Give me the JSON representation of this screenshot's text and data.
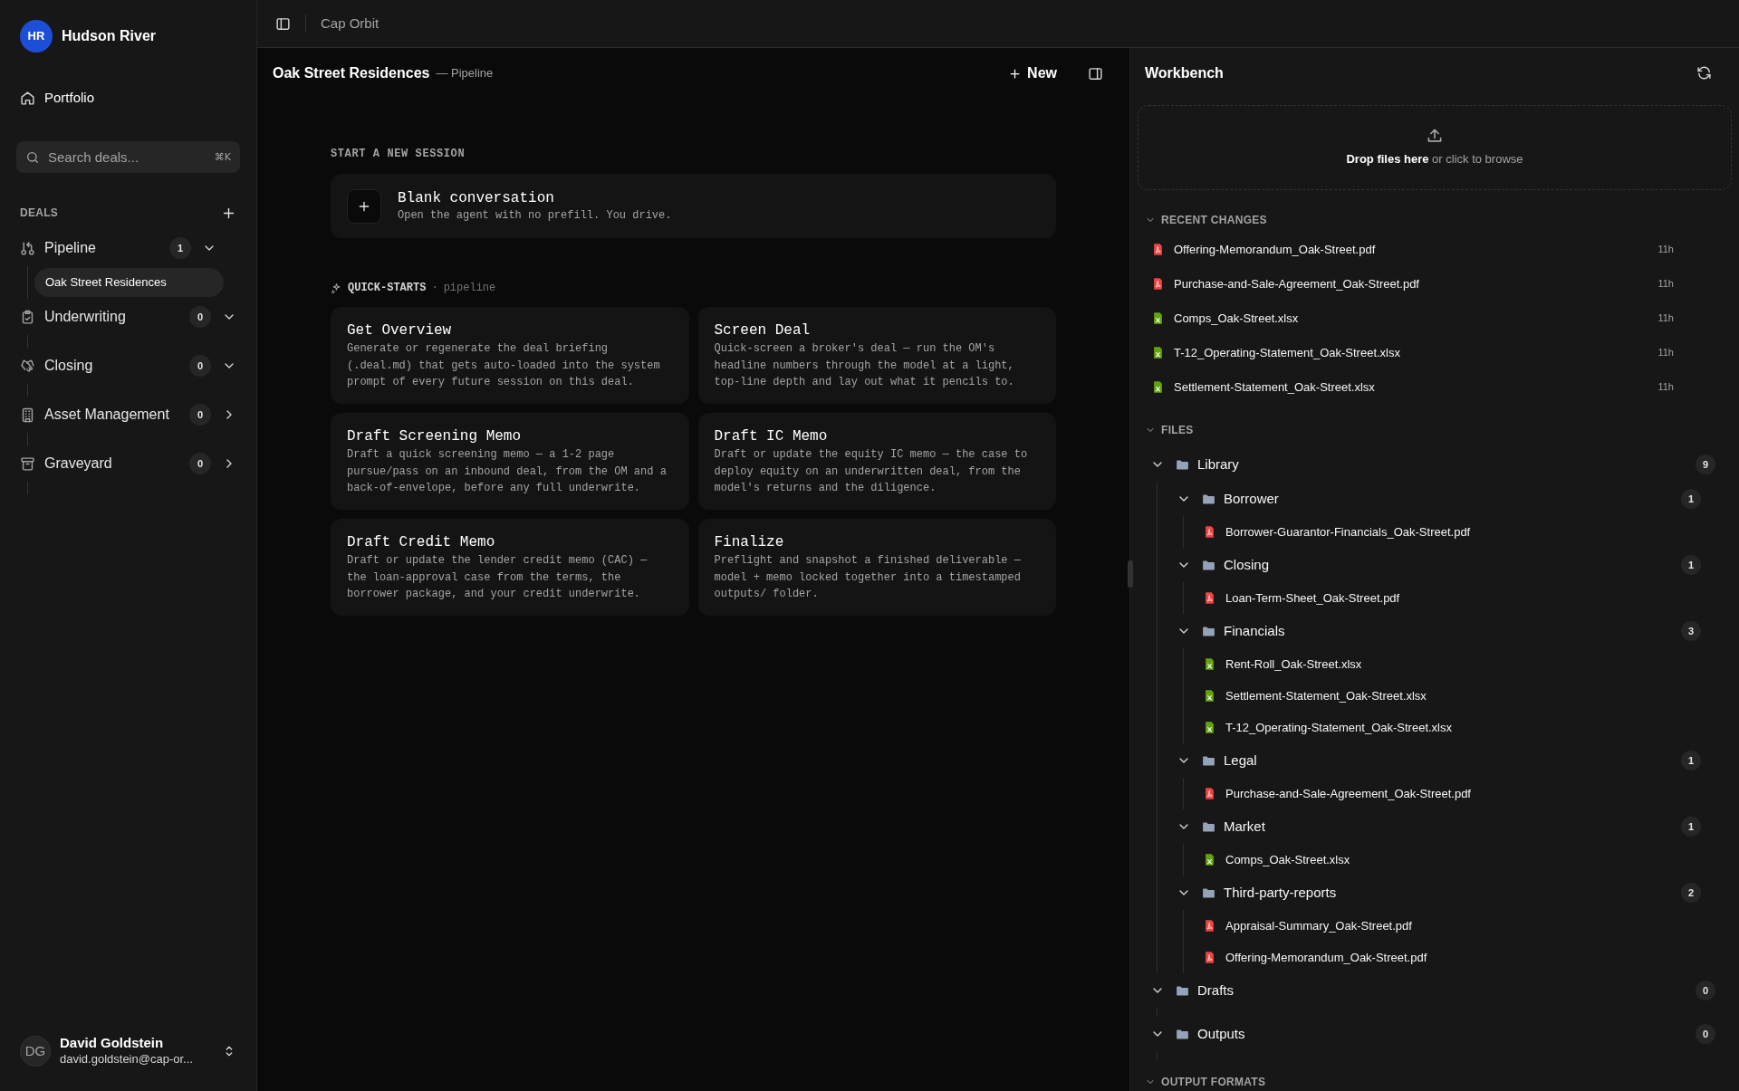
{
  "app": {
    "title": "Cap Orbit"
  },
  "workspace": {
    "initials": "HR",
    "name": "Hudson River"
  },
  "nav": [
    {
      "label": "Portfolio",
      "selected": false
    }
  ],
  "search": {
    "placeholder": "Search deals...",
    "shortcut": "⌘K"
  },
  "deals": {
    "heading": "DEALS",
    "stages": [
      {
        "label": "Pipeline",
        "kind": "pipeline",
        "count": "1",
        "expanded": true,
        "children": [
          {
            "label": "Oak Street Residences",
            "selected": true
          }
        ]
      },
      {
        "label": "Underwriting",
        "kind": "underwriting",
        "count": "0",
        "expanded": true
      },
      {
        "label": "Closing",
        "kind": "closing",
        "count": "0",
        "expanded": true
      },
      {
        "label": "Asset Management",
        "kind": "asset",
        "count": "0",
        "expanded": false
      },
      {
        "label": "Graveyard",
        "kind": "graveyard",
        "count": "0",
        "expanded": false
      }
    ]
  },
  "user": {
    "initials": "DG",
    "name": "David Goldstein",
    "email": "david.goldstein@cap-or..."
  },
  "header": {
    "title": "Oak Street Residences",
    "subtitle": "— Pipeline",
    "new_button": "New"
  },
  "session": {
    "heading": "START A NEW SESSION",
    "blank": {
      "title": "Blank conversation",
      "description": "Open the agent with no prefill. You drive."
    }
  },
  "quick_starts": {
    "heading": "QUICK-STARTS",
    "separator": "·",
    "scope": "pipeline",
    "cards": [
      {
        "title": "Get Overview",
        "description": "Generate or regenerate the deal briefing (.deal.md) that gets auto-loaded into the system prompt of every future session on this deal."
      },
      {
        "title": "Screen Deal",
        "description": "Quick-screen a broker's deal — run the OM's headline numbers through the model at a light, top-line depth and lay out what it pencils to."
      },
      {
        "title": "Draft Screening Memo",
        "description": "Draft a quick screening memo — a 1-2 page pursue/pass on an inbound deal, from the OM and a back-of-envelope, before any full underwrite."
      },
      {
        "title": "Draft IC Memo",
        "description": "Draft or update the equity IC memo — the case to deploy equity on an underwritten deal, from the model's returns and the diligence."
      },
      {
        "title": "Draft Credit Memo",
        "description": "Draft or update the lender credit memo (CAC) — the loan-approval case from the terms, the borrower package, and your credit underwrite."
      },
      {
        "title": "Finalize",
        "description": "Preflight and snapshot a finished deliverable — model + memo locked together into a timestamped outputs/ folder."
      }
    ]
  },
  "workbench": {
    "title": "Workbench",
    "drop_zone": "**Drop files here** or click to browse",
    "recent": {
      "heading": "RECENT CHANGES",
      "expanded": true,
      "items": [
        {
          "name": "Offering-Memorandum_Oak-Street.pdf",
          "kind": "pdf",
          "time": "11h"
        },
        {
          "name": "Purchase-and-Sale-Agreement_Oak-Street.pdf",
          "kind": "pdf",
          "time": "11h"
        },
        {
          "name": "Comps_Oak-Street.xlsx",
          "kind": "xlsx",
          "time": "11h"
        },
        {
          "name": "T-12_Operating-Statement_Oak-Street.xlsx",
          "kind": "xlsx",
          "time": "11h"
        },
        {
          "name": "Settlement-Statement_Oak-Street.xlsx",
          "kind": "xlsx",
          "time": "11h"
        }
      ]
    },
    "files": {
      "heading": "FILES",
      "expanded": true,
      "tree": [
        {
          "name": "Library",
          "kind": "folder",
          "count": "9",
          "expanded": true,
          "children": [
            {
              "name": "Borrower",
              "kind": "folder",
              "count": "1",
              "expanded": true,
              "children": [
                {
                  "name": "Borrower-Guarantor-Financials_Oak-Street.pdf",
                  "kind": "pdf"
                }
              ]
            },
            {
              "name": "Closing",
              "kind": "folder",
              "count": "1",
              "expanded": true,
              "children": [
                {
                  "name": "Loan-Term-Sheet_Oak-Street.pdf",
                  "kind": "pdf"
                }
              ]
            },
            {
              "name": "Financials",
              "kind": "folder",
              "count": "3",
              "expanded": true,
              "children": [
                {
                  "name": "Rent-Roll_Oak-Street.xlsx",
                  "kind": "xlsx"
                },
                {
                  "name": "Settlement-Statement_Oak-Street.xlsx",
                  "kind": "xlsx"
                },
                {
                  "name": "T-12_Operating-Statement_Oak-Street.xlsx",
                  "kind": "xlsx"
                }
              ]
            },
            {
              "name": "Legal",
              "kind": "folder",
              "count": "1",
              "expanded": true,
              "children": [
                {
                  "name": "Purchase-and-Sale-Agreement_Oak-Street.pdf",
                  "kind": "pdf"
                }
              ]
            },
            {
              "name": "Market",
              "kind": "folder",
              "count": "1",
              "expanded": true,
              "children": [
                {
                  "name": "Comps_Oak-Street.xlsx",
                  "kind": "xlsx"
                }
              ]
            },
            {
              "name": "Third-party-reports",
              "kind": "folder",
              "count": "2",
              "expanded": true,
              "children": [
                {
                  "name": "Appraisal-Summary_Oak-Street.pdf",
                  "kind": "pdf"
                },
                {
                  "name": "Offering-Memorandum_Oak-Street.pdf",
                  "kind": "pdf"
                }
              ]
            }
          ]
        },
        {
          "name": "Drafts",
          "kind": "folder",
          "count": "0",
          "expanded": true
        },
        {
          "name": "Outputs",
          "kind": "folder",
          "count": "0",
          "expanded": true
        }
      ]
    },
    "next_section": {
      "heading": "OUTPUT FORMATS",
      "expanded": true
    }
  }
}
